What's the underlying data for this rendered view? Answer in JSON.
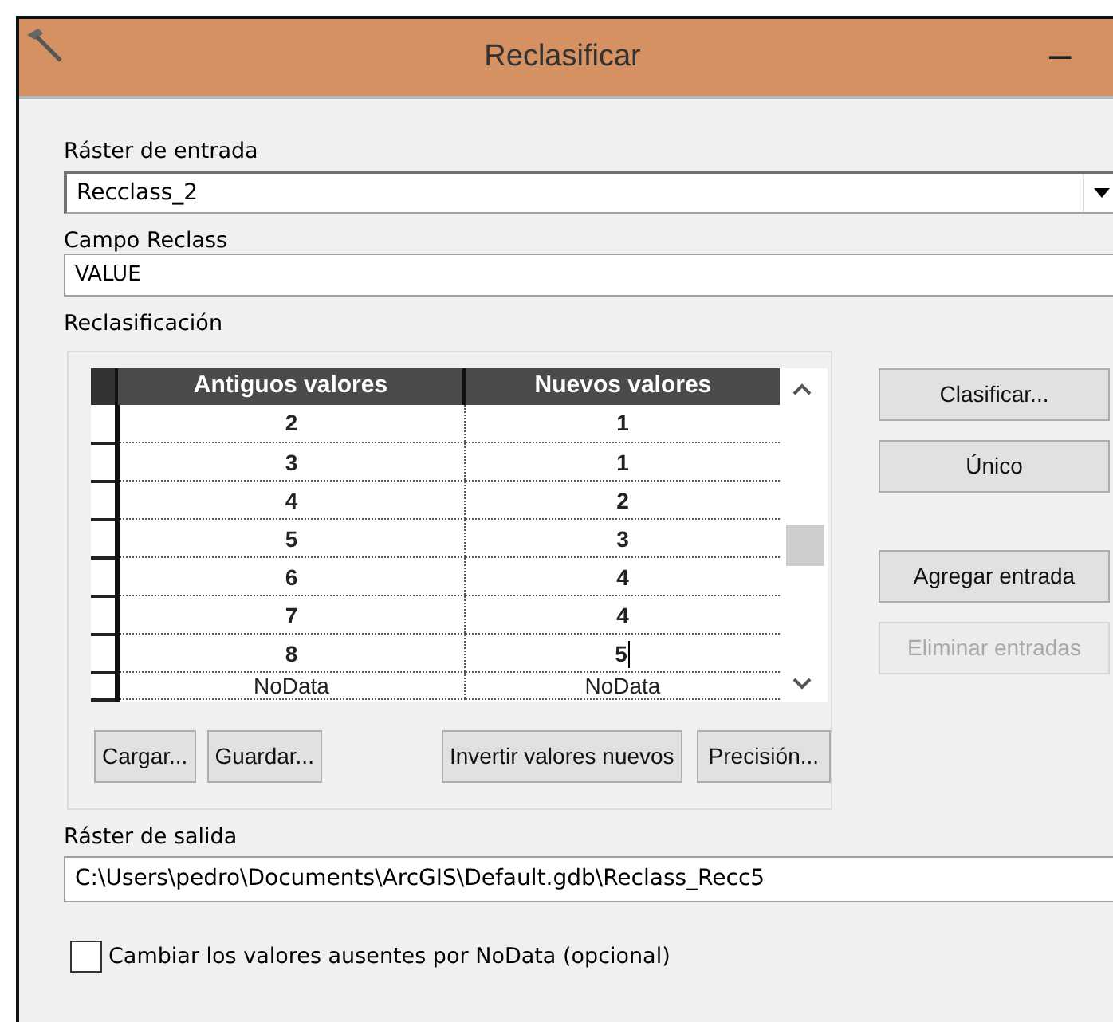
{
  "window": {
    "title": "Reclasificar",
    "minimize": "−"
  },
  "input_raster": {
    "label": "Ráster de entrada",
    "value": "Recclass_2"
  },
  "reclass_field": {
    "label": "Campo Reclass",
    "value": "VALUE"
  },
  "reclassification": {
    "label": "Reclasificación",
    "columns": [
      "Antiguos valores",
      "Nuevos valores"
    ],
    "rows": [
      {
        "old": "2",
        "new": "1",
        "editing": false
      },
      {
        "old": "3",
        "new": "1",
        "editing": false
      },
      {
        "old": "4",
        "new": "2",
        "editing": false
      },
      {
        "old": "5",
        "new": "3",
        "editing": false
      },
      {
        "old": "6",
        "new": "4",
        "editing": false
      },
      {
        "old": "7",
        "new": "4",
        "editing": false
      },
      {
        "old": "8",
        "new": "5",
        "editing": true
      },
      {
        "old": "NoData",
        "new": "NoData",
        "editing": false
      }
    ],
    "side_buttons": [
      {
        "label": "Clasificar...",
        "disabled": false
      },
      {
        "label": "Único",
        "disabled": false
      },
      {
        "label": "Agregar entrada",
        "disabled": false
      },
      {
        "label": "Eliminar entradas",
        "disabled": true
      }
    ],
    "bottom_buttons": [
      {
        "label": "Cargar..."
      },
      {
        "label": "Guardar..."
      },
      {
        "label": "Invertir valores nuevos"
      },
      {
        "label": "Precisión..."
      }
    ]
  },
  "output_raster": {
    "label": "Ráster de salida",
    "value": "C:\\Users\\pedro\\Documents\\ArcGIS\\Default.gdb\\Reclass_Recc5"
  },
  "nodata_option": {
    "label": "Cambiar los valores ausentes por NoData (opcional)",
    "checked": false
  }
}
